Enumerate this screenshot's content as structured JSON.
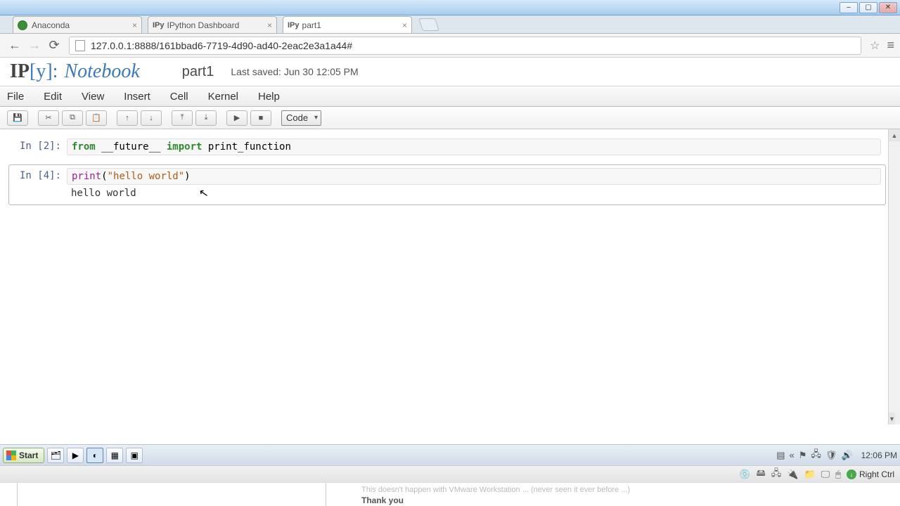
{
  "window": {
    "min": "–",
    "max": "▢",
    "close": "✕"
  },
  "tabs": [
    {
      "label": "Anaconda",
      "favicon": "anaconda",
      "active": false
    },
    {
      "label": "IPython Dashboard",
      "favicon": "ipy",
      "active": false
    },
    {
      "label": "part1",
      "favicon": "ipy",
      "active": true
    }
  ],
  "favicon_ipy": "IPy",
  "address": {
    "url": "127.0.0.1:8888/161bbad6-7719-4d90-ad40-2eac2e3a1a44#"
  },
  "notebook": {
    "logo_ip": "IP",
    "logo_y": "[y]",
    "logo_colon": ":",
    "logo_word": "Notebook",
    "title": "part1",
    "saved": "Last saved: Jun 30 12:05 PM"
  },
  "menu": {
    "file": "File",
    "edit": "Edit",
    "view": "View",
    "insert": "Insert",
    "cell": "Cell",
    "kernel": "Kernel",
    "help": "Help"
  },
  "toolbar": {
    "save": "💾",
    "cut": "✂",
    "copy": "⧉",
    "paste": "📋",
    "up": "↑",
    "down": "↓",
    "insert_above": "⤒",
    "insert_below": "⤓",
    "run": "▶",
    "stop": "■",
    "cell_type": "Code"
  },
  "cells": [
    {
      "prompt": "In [2]:",
      "code": {
        "t1": "from",
        "t2": " __future__ ",
        "t3": "import",
        "t4": " print_function"
      },
      "selected": false
    },
    {
      "prompt": "In [4]:",
      "code": {
        "t1": "print",
        "t2": "(",
        "t3": "\"hello world\"",
        "t4": ")"
      },
      "output": "hello world",
      "selected": true
    }
  ],
  "taskbar": {
    "start": "Start",
    "clock": "12:06 PM"
  },
  "vmbar": {
    "label": "Right Ctrl"
  },
  "bottom": {
    "faint": "This doesn't happen with VMware Workstation ... (never seen it ever before ...)",
    "thanks": "Thank you"
  }
}
